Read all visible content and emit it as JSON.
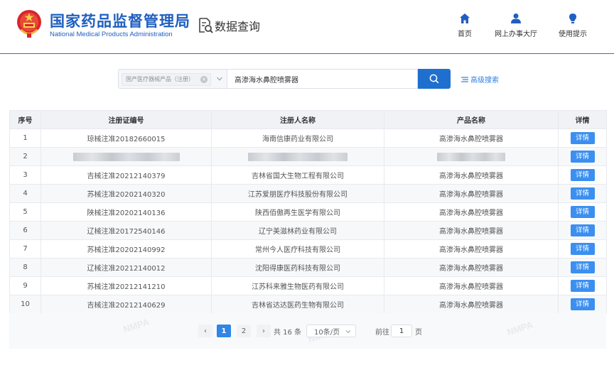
{
  "header": {
    "title_cn": "国家药品监督管理局",
    "title_en": "National Medical Products Administration",
    "section": "数据查询",
    "nav": [
      {
        "label": "首页",
        "icon": "home-icon"
      },
      {
        "label": "网上办事大厅",
        "icon": "user-icon"
      },
      {
        "label": "使用提示",
        "icon": "lightbulb-icon"
      }
    ]
  },
  "search": {
    "category": "国产医疗器械产品（注册）",
    "keyword": "高渗海水鼻腔喷雾器",
    "advanced_label": "高级搜索"
  },
  "table": {
    "columns": [
      "序号",
      "注册证编号",
      "注册人名称",
      "产品名称",
      "详情"
    ],
    "detail_label": "详情",
    "rows": [
      {
        "no": "1",
        "cert": "琼械注准20182660015",
        "registrant": "海南信康药业有限公司",
        "product": "高渗海水鼻腔喷雾器"
      },
      {
        "no": "2",
        "cert": "",
        "registrant": "",
        "product": ""
      },
      {
        "no": "3",
        "cert": "吉械注准20212140379",
        "registrant": "吉林省国大生物工程有限公司",
        "product": "高渗海水鼻腔喷雾器"
      },
      {
        "no": "4",
        "cert": "苏械注准20202140320",
        "registrant": "江苏爱朋医疗科技股份有限公司",
        "product": "高渗海水鼻腔喷雾器"
      },
      {
        "no": "5",
        "cert": "陕械注准20202140136",
        "registrant": "陕西佰傲再生医学有限公司",
        "product": "高渗海水鼻腔喷雾器"
      },
      {
        "no": "6",
        "cert": "辽械注准20172540146",
        "registrant": "辽宁美滋林药业有限公司",
        "product": "高渗海水鼻腔喷雾器"
      },
      {
        "no": "7",
        "cert": "苏械注准20202140992",
        "registrant": "常州今人医疗科技有限公司",
        "product": "高渗海水鼻腔喷雾器"
      },
      {
        "no": "8",
        "cert": "辽械注准20212140012",
        "registrant": "沈阳得康医药科技有限公司",
        "product": "高渗海水鼻腔喷雾器"
      },
      {
        "no": "9",
        "cert": "苏械注准20212141210",
        "registrant": "江苏科来雅生物医药有限公司",
        "product": "高渗海水鼻腔喷雾器"
      },
      {
        "no": "10",
        "cert": "吉械注准20212140629",
        "registrant": "吉林省达达医药生物有限公司",
        "product": "高渗海水鼻腔喷雾器"
      }
    ]
  },
  "pagination": {
    "prev": "‹",
    "pages": [
      "1",
      "2"
    ],
    "next": "›",
    "total": "共 16 条",
    "page_size": "10条/页",
    "goto_label": "前往",
    "goto_value": "1",
    "page_unit": "页"
  },
  "watermark": "NMPA",
  "colors": {
    "brand": "#1f5fbf",
    "primary": "#1f6fce",
    "detail": "#3b8ff0"
  }
}
